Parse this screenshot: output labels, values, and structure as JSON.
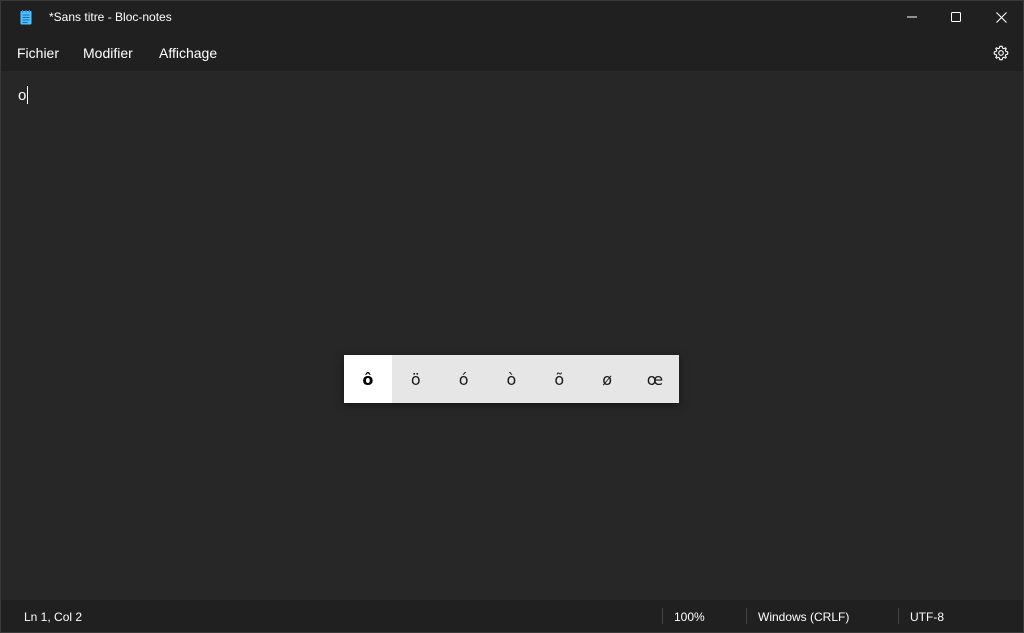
{
  "window": {
    "title": "*Sans titre - Bloc-notes",
    "icon": "notepad-icon"
  },
  "menu": {
    "items": [
      {
        "label": "Fichier"
      },
      {
        "label": "Modifier"
      },
      {
        "label": "Affichage"
      }
    ],
    "settings_icon": "gear-icon"
  },
  "editor": {
    "content": "o"
  },
  "accent_popup": {
    "selected_index": 0,
    "characters": [
      "ô",
      "ö",
      "ó",
      "ò",
      "õ",
      "ø",
      "œ"
    ]
  },
  "status": {
    "position": "Ln 1, Col 2",
    "zoom": "100%",
    "line_ending": "Windows (CRLF)",
    "encoding": "UTF-8"
  },
  "colors": {
    "background": "#272727",
    "chrome": "#202020",
    "popup": "#e6e6e6",
    "popup_selected": "#ffffff",
    "notepad_icon": "#4fc3f7"
  }
}
